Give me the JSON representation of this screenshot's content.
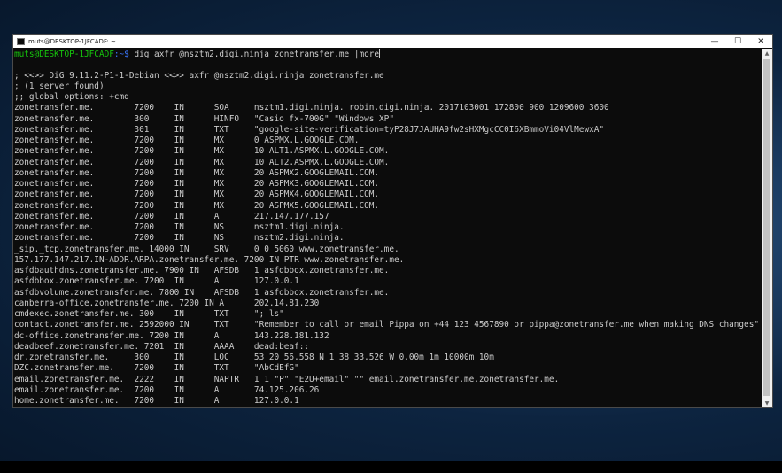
{
  "window": {
    "title": "muts@DESKTOP-1JFCADF: ~",
    "controls": {
      "minimize": "—",
      "maximize": "☐",
      "close": "✕"
    }
  },
  "terminal": {
    "prompt_user": "muts@DESKTOP-1JFCADF",
    "prompt_path": ":~$",
    "command": " dig axfr @nsztm2.digi.ninja zonetransfer.me |more",
    "lines": [
      "",
      "; <<>> DiG 9.11.2-P1-1-Debian <<>> axfr @nsztm2.digi.ninja zonetransfer.me",
      "; (1 server found)",
      ";; global options: +cmd",
      "zonetransfer.me.        7200    IN      SOA     nsztm1.digi.ninja. robin.digi.ninja. 2017103001 172800 900 1209600 3600",
      "zonetransfer.me.        300     IN      HINFO   \"Casio fx-700G\" \"Windows XP\"",
      "zonetransfer.me.        301     IN      TXT     \"google-site-verification=tyP28J7JAUHA9fw2sHXMgcCC0I6XBmmoVi04VlMewxA\"",
      "zonetransfer.me.        7200    IN      MX      0 ASPMX.L.GOOGLE.COM.",
      "zonetransfer.me.        7200    IN      MX      10 ALT1.ASPMX.L.GOOGLE.COM.",
      "zonetransfer.me.        7200    IN      MX      10 ALT2.ASPMX.L.GOOGLE.COM.",
      "zonetransfer.me.        7200    IN      MX      20 ASPMX2.GOOGLEMAIL.COM.",
      "zonetransfer.me.        7200    IN      MX      20 ASPMX3.GOOGLEMAIL.COM.",
      "zonetransfer.me.        7200    IN      MX      20 ASPMX4.GOOGLEMAIL.COM.",
      "zonetransfer.me.        7200    IN      MX      20 ASPMX5.GOOGLEMAIL.COM.",
      "zonetransfer.me.        7200    IN      A       217.147.177.157",
      "zonetransfer.me.        7200    IN      NS      nsztm1.digi.ninja.",
      "zonetransfer.me.        7200    IN      NS      nsztm2.digi.ninja.",
      "_sip._tcp.zonetransfer.me. 14000 IN     SRV     0 0 5060 www.zonetransfer.me.",
      "157.177.147.217.IN-ADDR.ARPA.zonetransfer.me. 7200 IN PTR www.zonetransfer.me.",
      "asfdbauthdns.zonetransfer.me. 7900 IN   AFSDB   1 asfdbbox.zonetransfer.me.",
      "asfdbbox.zonetransfer.me. 7200  IN      A       127.0.0.1",
      "asfdbvolume.zonetransfer.me. 7800 IN    AFSDB   1 asfdbbox.zonetransfer.me.",
      "canberra-office.zonetransfer.me. 7200 IN A      202.14.81.230",
      "cmdexec.zonetransfer.me. 300    IN      TXT     \"; ls\"",
      "contact.zonetransfer.me. 2592000 IN     TXT     \"Remember to call or email Pippa on +44 123 4567890 or pippa@zonetransfer.me when making DNS changes\"",
      "dc-office.zonetransfer.me. 7200 IN      A       143.228.181.132",
      "deadbeef.zonetransfer.me. 7201  IN      AAAA    dead:beaf::",
      "dr.zonetransfer.me.     300     IN      LOC     53 20 56.558 N 1 38 33.526 W 0.00m 1m 10000m 10m",
      "DZC.zonetransfer.me.    7200    IN      TXT     \"AbCdEfG\"",
      "email.zonetransfer.me.  2222    IN      NAPTR   1 1 \"P\" \"E2U+email\" \"\" email.zonetransfer.me.zonetransfer.me.",
      "email.zonetransfer.me.  7200    IN      A       74.125.206.26",
      "home.zonetransfer.me.   7200    IN      A       127.0.0.1"
    ]
  },
  "colors": {
    "terminal_bg": "#0c0c0c",
    "terminal_fg": "#cccccc",
    "prompt_user": "#16c60c",
    "prompt_path": "#3b78ff"
  }
}
